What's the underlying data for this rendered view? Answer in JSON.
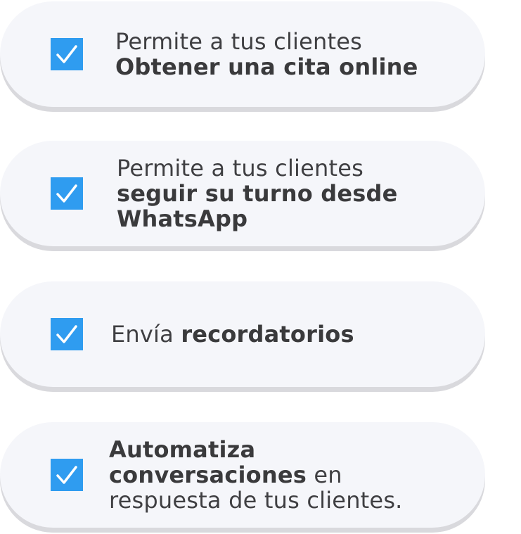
{
  "colors": {
    "card_background": "#f5f6fa",
    "card_shadow": "#d9d9dd",
    "checkbox": "#2f9cf0",
    "text": "#3a3a3c"
  },
  "features": [
    {
      "checked": true,
      "line1": "Permite a tus clientes",
      "line2": "Obtener una cita online"
    },
    {
      "checked": true,
      "line1": "Permite a tus clientes",
      "line2": "seguir su turno desde",
      "line3": "WhatsApp"
    },
    {
      "checked": true,
      "prefix": "Envía ",
      "bold": "recordatorios"
    },
    {
      "checked": true,
      "line1": "Automatiza",
      "line2_bold": "conversaciones",
      "line2_rest": " en",
      "line3": "respuesta de tus clientes."
    }
  ]
}
